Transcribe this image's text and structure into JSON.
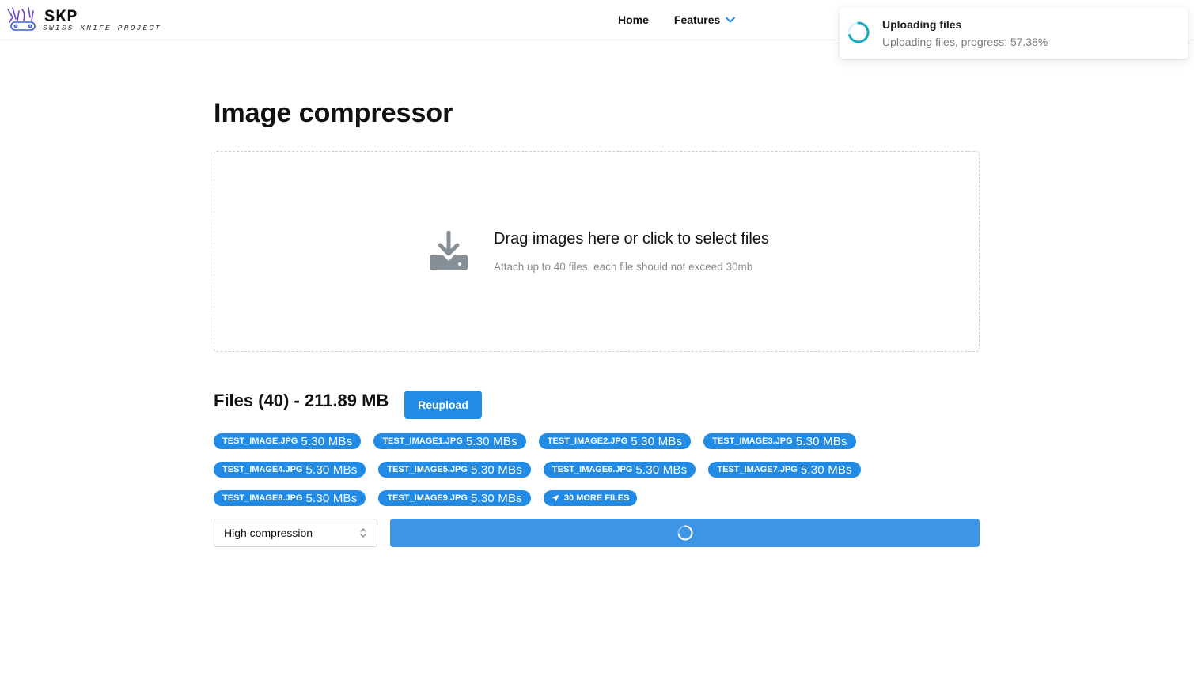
{
  "brand": {
    "title": "SKP",
    "subtitle": "SWISS KNIFE PROJECT"
  },
  "nav": {
    "home": "Home",
    "features": "Features"
  },
  "toast": {
    "title": "Uploading files",
    "message": "Uploading files, progress: 57.38%",
    "progress_percent": 57.38
  },
  "main": {
    "title": "Image compressor",
    "dropzone": {
      "title": "Drag images here or click to select files",
      "hint": "Attach up to 40 files, each file should not exceed 30mb"
    },
    "files": {
      "heading": "Files (40) - 211.89 MB",
      "reupload_label": "Reupload",
      "items": [
        {
          "name": "test_image.jpg",
          "size": "5.30 MBs"
        },
        {
          "name": "test_image1.jpg",
          "size": "5.30 MBs"
        },
        {
          "name": "test_image2.jpg",
          "size": "5.30 MBs"
        },
        {
          "name": "test_image3.jpg",
          "size": "5.30 MBs"
        },
        {
          "name": "test_image4.jpg",
          "size": "5.30 MBs"
        },
        {
          "name": "test_image5.jpg",
          "size": "5.30 MBs"
        },
        {
          "name": "test_image6.jpg",
          "size": "5.30 MBs"
        },
        {
          "name": "test_image7.jpg",
          "size": "5.30 MBs"
        },
        {
          "name": "test_image8.jpg",
          "size": "5.30 MBs"
        },
        {
          "name": "test_image9.jpg",
          "size": "5.30 MBs"
        }
      ],
      "more_label": "30 more files"
    },
    "compression": {
      "selected": "High compression"
    }
  },
  "colors": {
    "accent": "#228be6",
    "spinner": "#15aabf"
  },
  "icons": {
    "logo": "swiss-knife-logo-icon",
    "features_chevron": "chevron-down-icon",
    "toast_loader": "loader-icon",
    "dropzone": "download-tray-icon",
    "more_files": "send-arrow-icon",
    "select_caret": "selector-icon",
    "button_loader": "loader-icon"
  }
}
